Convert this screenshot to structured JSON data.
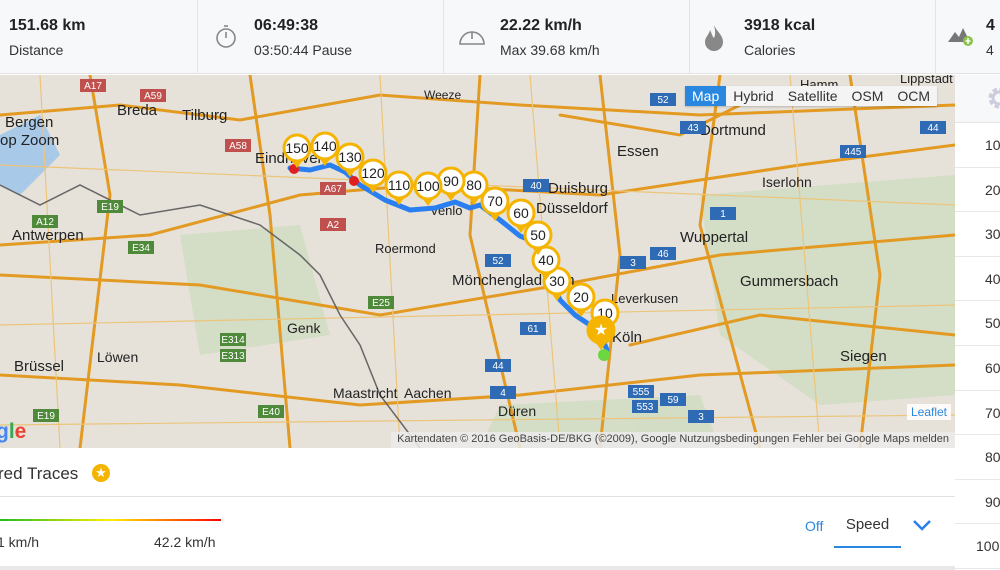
{
  "stats": [
    {
      "value": "151.68 km",
      "label": "Distance",
      "icon": "none"
    },
    {
      "value": "06:49:38",
      "label": "03:50:44 Pause",
      "icon": "stopwatch-icon"
    },
    {
      "value": "22.22 km/h",
      "label": "Max 39.68 km/h",
      "icon": "speedometer-icon"
    },
    {
      "value": "3918 kcal",
      "label": "Calories",
      "icon": "flame-icon"
    },
    {
      "value": "4",
      "label": "4",
      "icon": "elevation-up-icon"
    }
  ],
  "map": {
    "layers": [
      "Map",
      "Hybrid",
      "Satellite",
      "OSM",
      "OCM"
    ],
    "active_layer": "Map",
    "attribution": "Kartendaten © 2016 GeoBasis-DE/BKG (©2009), Google   Nutzungsbedingungen   Fehler bei Google Maps melden",
    "leaflet": "Leaflet",
    "google_logo": "gle",
    "cities": [
      "Bergen",
      "op Zoom",
      "Breda",
      "Tilburg",
      "Eindhoven",
      "Antwerpen",
      "Roermond",
      "Venlo",
      "Mönchengladbach",
      "Düsseldorf",
      "Duisburg",
      "Essen",
      "Dortmund",
      "Iserlohn",
      "Wuppertal",
      "Leverkusen",
      "Köln",
      "Gummersbach",
      "Siegen",
      "Genk",
      "Maastricht",
      "Aachen",
      "Düren",
      "Brüssel",
      "Löwen",
      "Weeze",
      "Hamm",
      "Lippstadt"
    ],
    "road_labels": [
      "A17",
      "A59",
      "A58",
      "A67",
      "A2",
      "A12",
      "E19",
      "E34",
      "E25",
      "E314",
      "E313",
      "E40",
      "E19",
      "52",
      "40",
      "43",
      "44",
      "445",
      "1",
      "3",
      "46",
      "52",
      "61",
      "44",
      "4",
      "555",
      "553",
      "59",
      "3"
    ],
    "km_markers": [
      "10",
      "20",
      "30",
      "40",
      "50",
      "60",
      "70",
      "80",
      "90",
      "100",
      "110",
      "120",
      "130",
      "140",
      "150"
    ],
    "route_color": "#2a7ff0",
    "marker_color": "#f5b400"
  },
  "panel": {
    "title": "red Traces",
    "legend_min": "1 km/h",
    "legend_max": "42.2 km/h",
    "off_label": "Off",
    "speed_label": "Speed"
  },
  "splits": [
    "10",
    "20",
    "30",
    "40",
    "50",
    "60",
    "70",
    "80",
    "90",
    "100"
  ]
}
